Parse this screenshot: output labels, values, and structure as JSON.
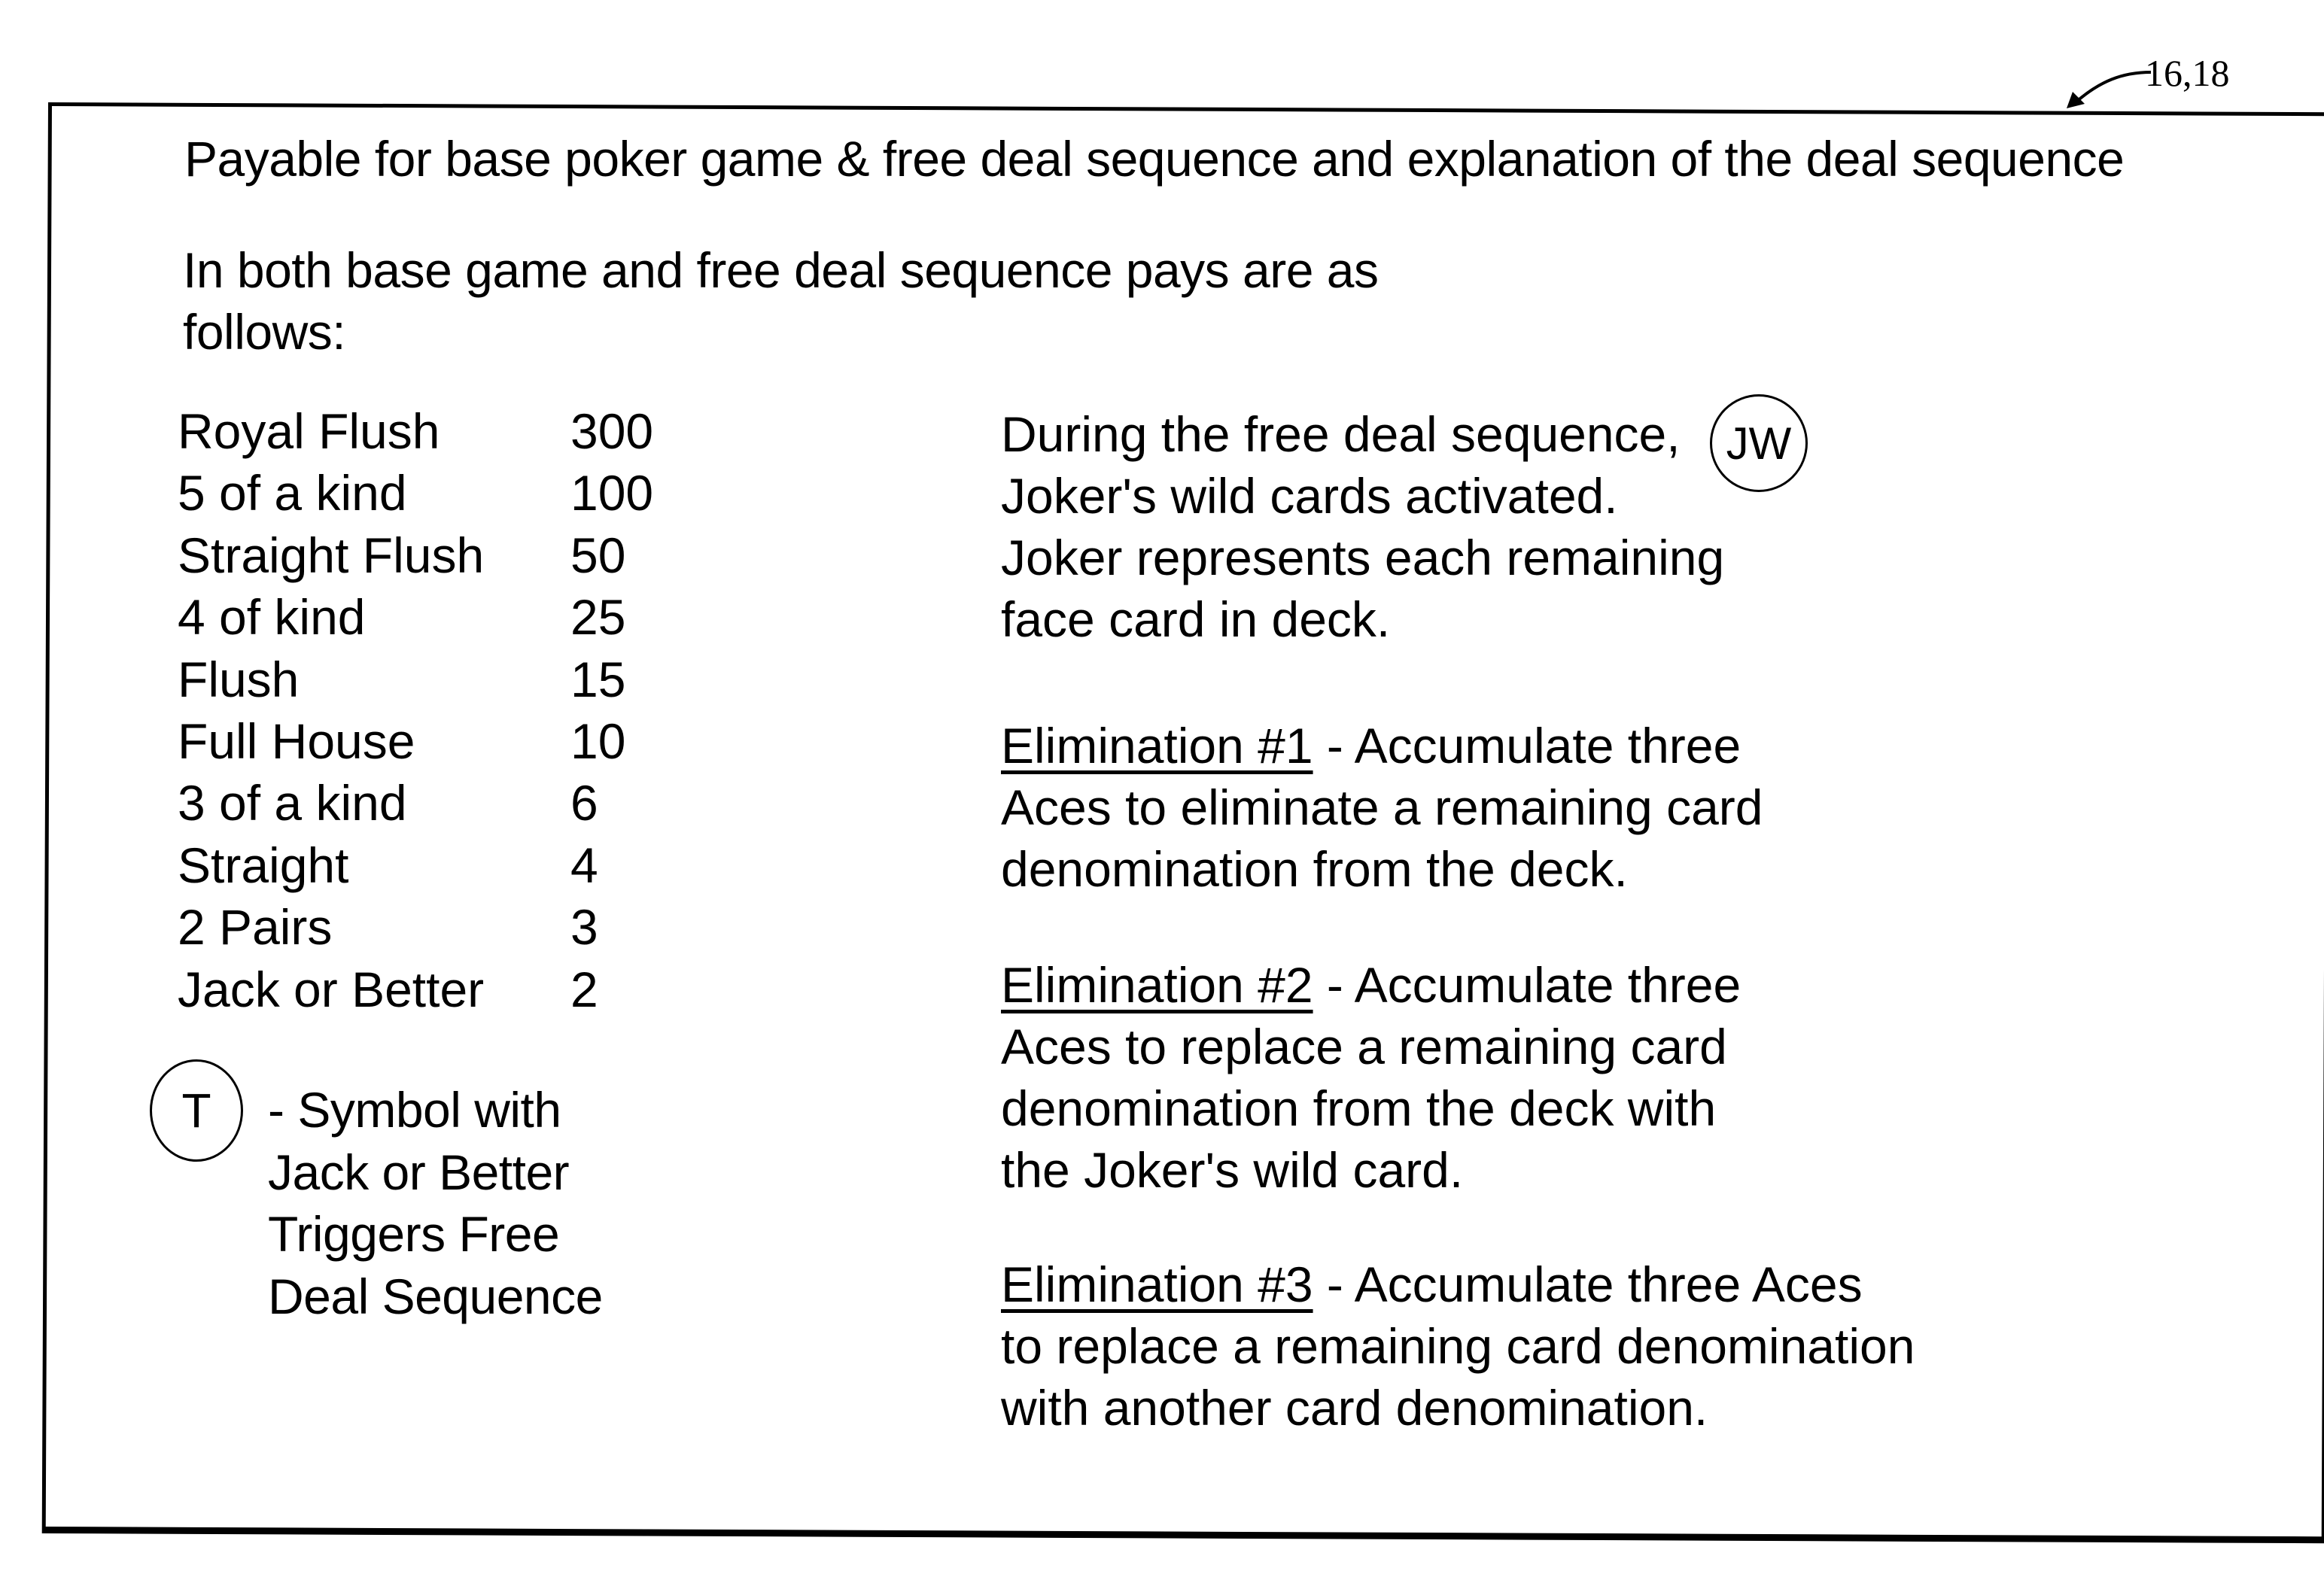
{
  "reference_label": "16,18",
  "title": "Payable for base poker game & free deal sequence and explanation of the deal sequence",
  "intro": [
    "In both base game and free deal sequence pays are as",
    "follows:"
  ],
  "paytable": [
    {
      "hand": "Royal Flush",
      "pay": "300"
    },
    {
      "hand": "5 of a kind",
      "pay": "100"
    },
    {
      "hand": "Straight Flush",
      "pay": "50"
    },
    {
      "hand": "4 of kind",
      "pay": "25"
    },
    {
      "hand": "Flush",
      "pay": "15"
    },
    {
      "hand": "Full House",
      "pay": "10"
    },
    {
      "hand": "3 of a kind",
      "pay": "6"
    },
    {
      "hand": "Straight",
      "pay": "4"
    },
    {
      "hand": "2 Pairs",
      "pay": "3"
    },
    {
      "hand": "Jack or Better",
      "pay": "2"
    }
  ],
  "trigger_symbol": {
    "symbol": "T",
    "lines": [
      "- Symbol with",
      "Jack or Better",
      "Triggers Free",
      "Deal Sequence"
    ]
  },
  "joker": {
    "symbol": "JW",
    "lines": [
      "During the free deal sequence,",
      "Joker's wild cards activated.",
      "Joker represents each remaining",
      "face card in deck."
    ]
  },
  "eliminations": [
    {
      "label": "Elimination #1",
      "lines": [
        " - Accumulate three",
        "Aces to eliminate a remaining card",
        "denomination from the deck."
      ]
    },
    {
      "label": "Elimination #2",
      "lines": [
        " - Accumulate three",
        "Aces to replace a remaining card",
        "denomination from the deck with",
        "the Joker's wild card."
      ]
    },
    {
      "label": "Elimination #3",
      "lines": [
        " - Accumulate three Aces",
        "to replace a remaining card denomination",
        "with another card denomination."
      ]
    }
  ]
}
